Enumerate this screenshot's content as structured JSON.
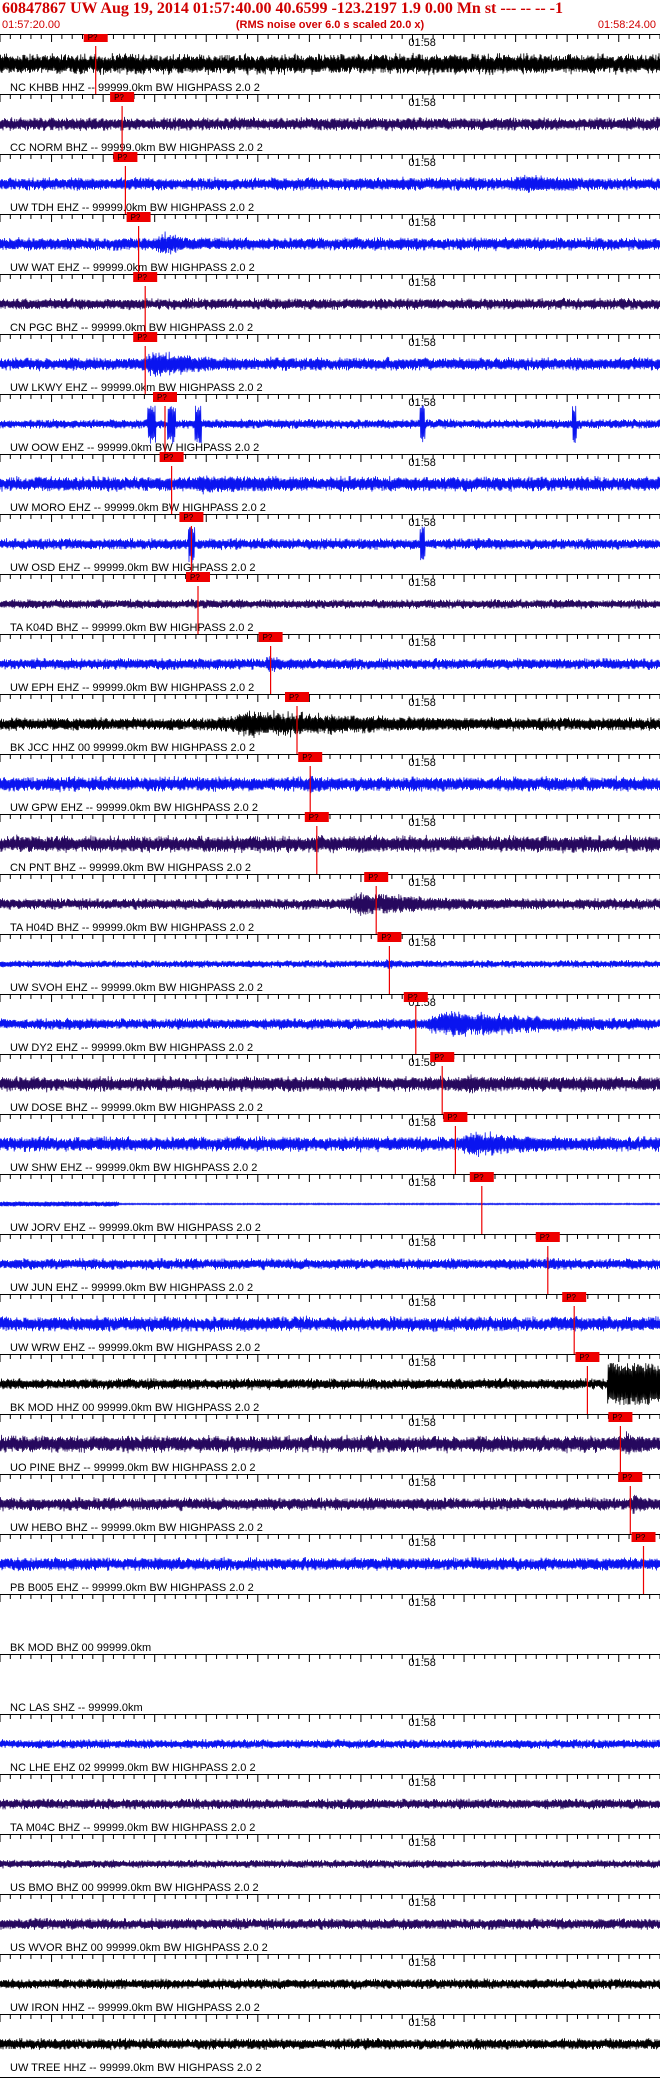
{
  "header": {
    "title": "60847867 UW Aug 19, 2014 01:57:40.00   40.6599 -123.2197  1.9 0.00 Mn st --- -- --   -1",
    "start_time": "01:57:20.00",
    "end_time": "01:58:24.00",
    "rms_note": "(RMS noise over 6.0 s scaled 20.0 x)"
  },
  "plot": {
    "tick_label": "01:58",
    "pick_label": "P?",
    "colors": {
      "black": "#000000",
      "blue": "#0a14f0",
      "purple": "#26085e",
      "pick": "#ee0000"
    }
  },
  "traces": [
    {
      "label": "NC KHBB HHZ -- 99999.0km BW  HIGHPASS  2.0  2",
      "color": "black",
      "pick": 0.145,
      "style": "burst",
      "burst": [
        0.12,
        0.62,
        0.55
      ],
      "amp": 0.55
    },
    {
      "label": "CC NORM BHZ -- 99999.0km BW  HIGHPASS  2.0  2",
      "color": "purple",
      "pick": 0.185,
      "style": "noise",
      "amp": 0.35
    },
    {
      "label": "UW TDH EHZ -- 99999.0km BW  HIGHPASS  2.0  2",
      "color": "blue",
      "pick": 0.19,
      "style": "burst",
      "burst": [
        0.75,
        1.0,
        0.65
      ],
      "amp": 0.35
    },
    {
      "label": "UW WAT EHZ -- 99999.0km BW  HIGHPASS  2.0  2",
      "color": "blue",
      "pick": 0.21,
      "style": "burst",
      "burst": [
        0.23,
        0.32,
        0.85
      ],
      "amp": 0.35
    },
    {
      "label": "CN PGC BHZ -- 99999.0km BW  HIGHPASS  2.0  2",
      "color": "purple",
      "pick": 0.22,
      "style": "noise",
      "amp": 0.3
    },
    {
      "label": "UW LKWY EHZ -- 99999.0km BW  HIGHPASS  2.0  2",
      "color": "blue",
      "pick": 0.22,
      "style": "burst",
      "burst": [
        0.2,
        0.4,
        0.9
      ],
      "amp": 0.35
    },
    {
      "label": "UW OOW EHZ -- 99999.0km BW  HIGHPASS  2.0  2",
      "color": "blue",
      "pick": 0.25,
      "style": "spikes",
      "amp": 0.25
    },
    {
      "label": "UW MORO EHZ -- 99999.0km BW  HIGHPASS  2.0  2",
      "color": "blue",
      "pick": 0.26,
      "style": "burst",
      "burst": [
        0.26,
        0.55,
        0.7
      ],
      "amp": 0.4
    },
    {
      "label": "UW OSD EHZ -- 99999.0km BW  HIGHPASS  2.0  2",
      "color": "blue",
      "pick": 0.29,
      "style": "spikes2",
      "amp": 0.3
    },
    {
      "label": "TA K04D BHZ -- 99999.0km BW  HIGHPASS  2.0  2",
      "color": "purple",
      "pick": 0.3,
      "style": "noise",
      "amp": 0.25
    },
    {
      "label": "UW EPH EHZ -- 99999.0km BW  HIGHPASS  2.0  2",
      "color": "blue",
      "pick": 0.41,
      "style": "burst",
      "burst": [
        0.4,
        0.44,
        0.7
      ],
      "amp": 0.3
    },
    {
      "label": "BK JCC HHZ 00 99999.0km BW  HIGHPASS  2.0  2",
      "color": "black",
      "pick": 0.45,
      "style": "burst",
      "burst": [
        0.3,
        0.8,
        0.95
      ],
      "amp": 0.35
    },
    {
      "label": "UW GPW EHZ -- 99999.0km BW  HIGHPASS  2.0  2",
      "color": "blue",
      "pick": 0.47,
      "style": "burst",
      "burst": [
        0.46,
        0.5,
        0.7
      ],
      "amp": 0.4
    },
    {
      "label": "CN PNT BHZ -- 99999.0km BW  HIGHPASS  2.0  2",
      "color": "purple",
      "pick": 0.48,
      "style": "burst",
      "burst": [
        0.48,
        0.9,
        0.6
      ],
      "amp": 0.45
    },
    {
      "label": "TA H04D BHZ -- 99999.0km BW  HIGHPASS  2.0  2",
      "color": "purple",
      "pick": 0.57,
      "style": "burst",
      "burst": [
        0.5,
        0.8,
        0.85
      ],
      "amp": 0.3
    },
    {
      "label": "UW SVOH EHZ -- 99999.0km BW  HIGHPASS  2.0  2",
      "color": "blue",
      "pick": 0.59,
      "style": "burst",
      "burst": [
        0.58,
        0.62,
        0.4
      ],
      "amp": 0.2
    },
    {
      "label": "UW DY2 EHZ -- 99999.0km BW  HIGHPASS  2.0  2",
      "color": "blue",
      "pick": 0.63,
      "style": "burst",
      "burst": [
        0.62,
        1.0,
        0.95
      ],
      "amp": 0.3
    },
    {
      "label": "UW DOSE BHZ -- 99999.0km BW  HIGHPASS  2.0  2",
      "color": "purple",
      "pick": 0.67,
      "style": "burst",
      "burst": [
        0.65,
        1.0,
        0.6
      ],
      "amp": 0.4
    },
    {
      "label": "UW SHW EHZ -- 99999.0km BW  HIGHPASS  2.0  2",
      "color": "blue",
      "pick": 0.69,
      "style": "burst",
      "burst": [
        0.68,
        0.9,
        0.95
      ],
      "amp": 0.4
    },
    {
      "label": "UW JORV EHZ -- 99999.0km BW  HIGHPASS  2.0  2",
      "color": "blue",
      "pick": 0.73,
      "style": "flat",
      "amp": 0.2
    },
    {
      "label": "UW JUN EHZ -- 99999.0km BW  HIGHPASS  2.0  2",
      "color": "blue",
      "pick": 0.83,
      "style": "burst",
      "burst": [
        0.82,
        0.88,
        0.6
      ],
      "amp": 0.3
    },
    {
      "label": "UW WRW EHZ -- 99999.0km BW  HIGHPASS  2.0  2",
      "color": "blue",
      "pick": 0.87,
      "style": "burst",
      "burst": [
        0.85,
        0.95,
        0.5
      ],
      "amp": 0.4
    },
    {
      "label": "BK MOD HHZ 00 99999.0km BW  HIGHPASS  2.0  2",
      "color": "black",
      "pick": 0.89,
      "style": "clip",
      "burst": [
        0.92,
        1.0,
        1.0
      ],
      "amp": 0.3
    },
    {
      "label": "UO PINE BHZ -- 99999.0km BW  HIGHPASS  2.0  2",
      "color": "purple",
      "pick": 0.94,
      "style": "burst",
      "burst": [
        0.94,
        1.0,
        0.9
      ],
      "amp": 0.45
    },
    {
      "label": "UW HEBO BHZ -- 99999.0km BW  HIGHPASS  2.0  2",
      "color": "purple",
      "pick": 0.955,
      "style": "burst",
      "burst": [
        0.95,
        1.0,
        0.75
      ],
      "amp": 0.35
    },
    {
      "label": "PB B005 EHZ -- 99999.0km BW  HIGHPASS  2.0  2",
      "color": "blue",
      "pick": 0.975,
      "style": "noise",
      "amp": 0.35
    },
    {
      "label": "BK MOD BHZ 00 99999.0km",
      "color": "black",
      "pick": null,
      "style": "empty",
      "amp": 0
    },
    {
      "label": "NC LAS SHZ -- 99999.0km",
      "color": "black",
      "pick": null,
      "style": "empty",
      "amp": 0
    },
    {
      "label": "NC LHE EHZ 02 99999.0km BW  HIGHPASS  2.0  2",
      "color": "blue",
      "pick": null,
      "style": "noise",
      "amp": 0.25
    },
    {
      "label": "TA M04C BHZ -- 99999.0km BW  HIGHPASS  2.0  2",
      "color": "purple",
      "pick": null,
      "style": "noise",
      "amp": 0.28
    },
    {
      "label": "US BMO BHZ 00 99999.0km BW  HIGHPASS  2.0  2",
      "color": "purple",
      "pick": null,
      "style": "noise",
      "amp": 0.22
    },
    {
      "label": "US WVOR BHZ 00 99999.0km BW  HIGHPASS  2.0  2",
      "color": "purple",
      "pick": null,
      "style": "noise",
      "amp": 0.3
    },
    {
      "label": "UW IRON HHZ -- 99999.0km BW  HIGHPASS  2.0  2",
      "color": "black",
      "pick": null,
      "style": "noise",
      "amp": 0.28
    },
    {
      "label": "UW TREE HHZ -- 99999.0km BW  HIGHPASS  2.0  2",
      "color": "black",
      "pick": null,
      "style": "noise",
      "amp": 0.3
    }
  ]
}
